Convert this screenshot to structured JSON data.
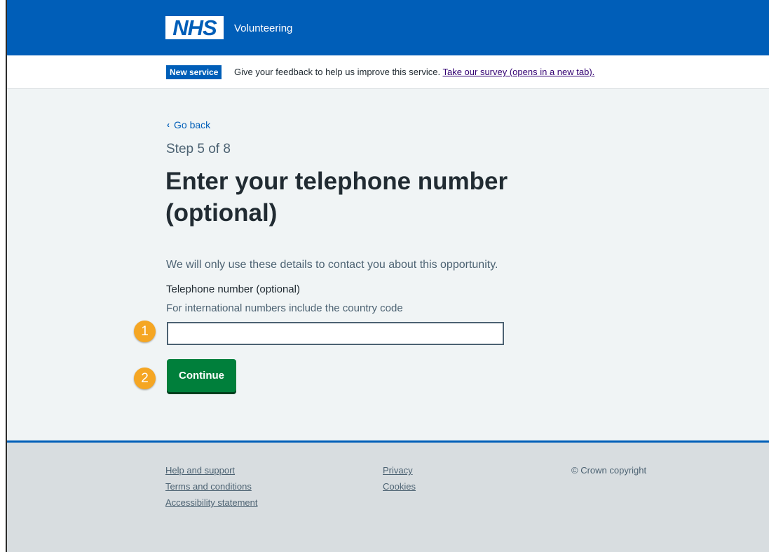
{
  "header": {
    "logo_text": "NHS",
    "service_name": "Volunteering",
    "brand_color": "#005eb8"
  },
  "phase_banner": {
    "tag": "New service",
    "text": "Give your feedback to help us improve this service.",
    "link_text": "Take our survey (opens in a new tab)."
  },
  "main": {
    "back_link": "Go back",
    "caption": "Step 5 of 8",
    "heading": "Enter your telephone number (optional)",
    "intro": "We will only use these details to contact you about this opportunity.",
    "field": {
      "label": "Telephone number (optional)",
      "hint": "For international numbers include the country code",
      "value": ""
    },
    "continue_label": "Continue",
    "button_color": "#007f3b"
  },
  "markers": [
    "1",
    "2"
  ],
  "footer": {
    "links_col1": [
      "Help and support",
      "Terms and conditions",
      "Accessibility statement"
    ],
    "links_col2": [
      "Privacy",
      "Cookies"
    ],
    "copyright": "© Crown copyright"
  }
}
